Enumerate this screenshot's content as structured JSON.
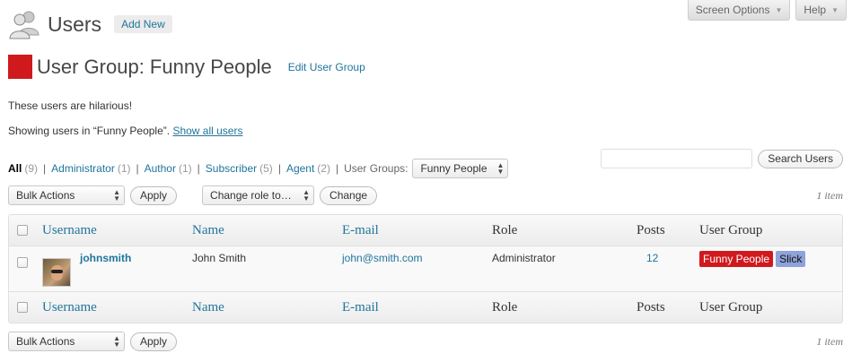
{
  "screen_meta": {
    "screen_options": "Screen Options",
    "help": "Help"
  },
  "header": {
    "title": "Users",
    "add_new": "Add New"
  },
  "group": {
    "title": "User Group: Funny People",
    "edit_link": "Edit User Group",
    "color": "#d0191d",
    "description": "These users are hilarious!",
    "showing_prefix": "Showing users in “Funny People”.",
    "show_all": "Show all users"
  },
  "filters": {
    "items": [
      {
        "label": "All",
        "count": "(9)"
      },
      {
        "label": "Administrator",
        "count": "(1)"
      },
      {
        "label": "Author",
        "count": "(1)"
      },
      {
        "label": "Subscriber",
        "count": "(5)"
      },
      {
        "label": "Agent",
        "count": "(2)"
      }
    ],
    "user_groups_label": "User Groups:",
    "user_groups_selected": "Funny People"
  },
  "search": {
    "button": "Search Users",
    "value": ""
  },
  "top_nav": {
    "bulk_actions": "Bulk Actions",
    "apply": "Apply",
    "change_role": "Change role to…",
    "change": "Change",
    "count": "1 item"
  },
  "bottom_nav": {
    "bulk_actions": "Bulk Actions",
    "apply": "Apply",
    "count": "1 item"
  },
  "table": {
    "columns": {
      "username": "Username",
      "name": "Name",
      "email": "E-mail",
      "role": "Role",
      "posts": "Posts",
      "user_group": "User Group"
    },
    "rows": [
      {
        "username": "johnsmith",
        "name": "John Smith",
        "email": "john@smith.com",
        "role": "Administrator",
        "posts": "12",
        "groups": [
          "Funny People",
          "Slick"
        ]
      }
    ]
  },
  "colors": {
    "link": "#21759b",
    "group_red": "#d0191d",
    "group_blue": "#8fa2d9"
  }
}
